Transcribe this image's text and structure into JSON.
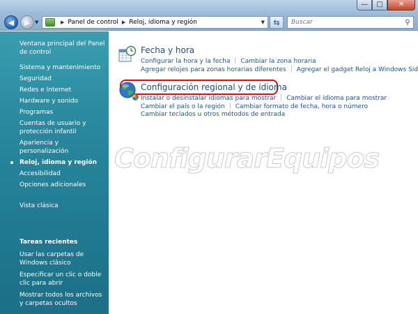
{
  "window": {
    "buttons": {
      "minimize": "—",
      "maximize": "□",
      "close": "✕"
    }
  },
  "address_bar": {
    "segments": [
      "Panel de control",
      "Reloj, idioma y región"
    ]
  },
  "search": {
    "placeholder": "Buscar"
  },
  "sidebar": {
    "home": "Ventana principal del Panel de control",
    "items": [
      "Sistema y mantenimiento",
      "Seguridad",
      "Redes e Internet",
      "Hardware y sonido",
      "Programas",
      "Cuentas de usuario y protección infantil",
      "Apariencia y personalización",
      "Reloj, idioma y región",
      "Accesibilidad",
      "Opciones adicionales"
    ],
    "classic": "Vista clásica",
    "recent_title": "Tareas recientes",
    "recent": [
      "Usar las carpetas de Windows clásico",
      "Especificar un clic o doble clic para abrir",
      "Mostrar todos los archivos y carpetas ocultos"
    ]
  },
  "main": {
    "datetime": {
      "title": "Fecha y hora",
      "links_row1": [
        "Configurar la hora y la fecha",
        "Cambiar la zona horaria"
      ],
      "links_row2": [
        "Agregar relojes para zonas horarias diferentes",
        "Agregar el gadget Reloj a Windows Sidebar"
      ]
    },
    "regional": {
      "title": "Configuración regional y de idioma",
      "links_row1": [
        "Instalar o desinstalar idiomas para mostrar",
        "Cambiar el idioma para mostrar"
      ],
      "links_row2": [
        "Cambiar el país o la región",
        "Cambiar formato de fecha, hora o número"
      ],
      "links_row3": [
        "Cambiar teclados u otros métodos de entrada"
      ]
    }
  },
  "watermark": "ConfigurarEquipos"
}
